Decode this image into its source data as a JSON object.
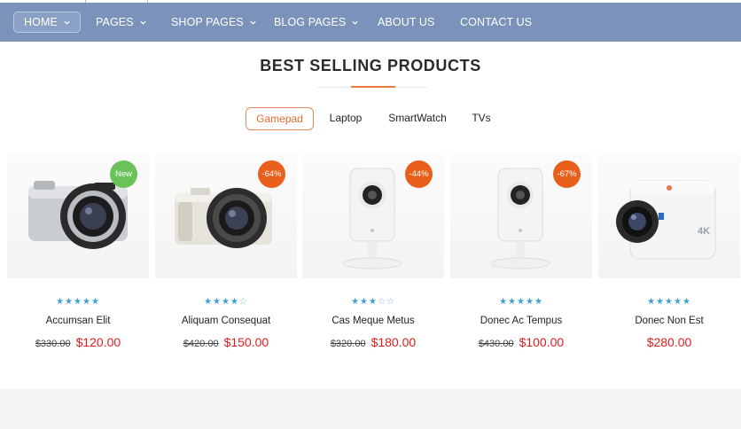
{
  "nav": {
    "items": [
      {
        "label": "HOME",
        "has_dropdown": true,
        "active": true
      },
      {
        "label": "PAGES",
        "has_dropdown": true
      },
      {
        "label": "SHOP PAGES",
        "has_dropdown": true
      },
      {
        "label": "BLOG PAGES",
        "has_dropdown": true
      },
      {
        "label": "ABOUT US",
        "has_dropdown": false
      },
      {
        "label": "CONTACT US",
        "has_dropdown": false
      }
    ]
  },
  "section": {
    "title": "BEST SELLING PRODUCTS"
  },
  "tabs": [
    {
      "label": "Gamepad",
      "active": true
    },
    {
      "label": "Laptop"
    },
    {
      "label": "SmartWatch"
    },
    {
      "label": "TVs"
    }
  ],
  "products": [
    {
      "name": "Accumsan Elit",
      "old_price": "$330.00",
      "price": "$120.00",
      "badge": "New",
      "rating": 5,
      "image": "mirrorless-camera-silver"
    },
    {
      "name": "Aliquam Consequat",
      "old_price": "$420.00",
      "price": "$150.00",
      "badge": "-64%",
      "rating": 4,
      "image": "mirrorless-camera-white"
    },
    {
      "name": "Cas Meque Metus",
      "old_price": "$320.00",
      "price": "$180.00",
      "badge": "-44%",
      "rating": 3,
      "image": "security-camera-white"
    },
    {
      "name": "Donec Ac Tempus",
      "old_price": "$430.00",
      "price": "$100.00",
      "badge": "-67%",
      "rating": 5,
      "image": "security-camera-white"
    },
    {
      "name": "Donec Non Est",
      "old_price": "",
      "price": "$280.00",
      "badge": "",
      "rating": 5,
      "image": "action-camera-4k",
      "image_text": "4K"
    }
  ],
  "colors": {
    "nav_bg": "#7b93ba",
    "accent": "#ec7a3a",
    "badge_new": "#6cc25a",
    "badge_sale": "#e8601c",
    "price": "#e11d1d",
    "stars": "#3c9fd0"
  }
}
